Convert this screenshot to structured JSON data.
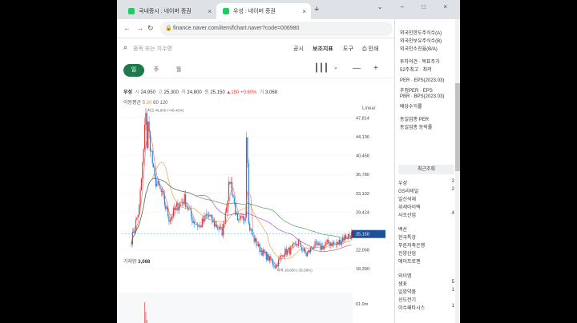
{
  "browser": {
    "tabs": [
      {
        "label": "국내증시 : 네이버 증권",
        "close": "×"
      },
      {
        "label": "우성 : 네이버 증권",
        "close": "×"
      }
    ],
    "new_tab": "+",
    "window_controls": "⌄ – □ ×",
    "url": "finance.naver.com/item/fchart.naver?code=006980"
  },
  "page": {
    "search_placeholder": "종목 또는 지수명",
    "header_links": [
      "공시",
      "보조지표",
      "도구",
      "인쇄"
    ],
    "periods": [
      "일",
      "주",
      "월"
    ],
    "active_period": "일",
    "quote": {
      "name": "우성",
      "open_label": "시",
      "open": "24,950",
      "high_label": "고",
      "high": "25,300",
      "low_label": "저",
      "low": "24,800",
      "close_label": "종",
      "close": "25,150",
      "change": "▲150",
      "change_pct": "+0.60%",
      "volume_label": "거",
      "volume": "3,068"
    },
    "ma_label": "이동평균",
    "ma_values": [
      "5",
      "20",
      "60",
      "120"
    ],
    "ma_colors": [
      "#ef5350",
      "#e08a2a",
      "#9c27b0",
      "#2e7d32"
    ],
    "scale_label": "Linear",
    "volume_title": "거래량",
    "volume_value": "3,068"
  },
  "chart_data": {
    "type": "line",
    "y_ticks": [
      "47,814",
      "44,136",
      "40,458",
      "36,780",
      "33,102",
      "29,424",
      "25,150",
      "22,068",
      "18,390"
    ],
    "current_price": "25,150",
    "max_annotation": "최고 48,800 (+48.46%)",
    "min_annotation": "최저 18,800 (-35.58%)",
    "x_ticks": [
      "4월",
      "8월",
      "2022",
      "4월",
      "8월",
      "2023",
      "4월"
    ],
    "volume_axis_label": "61.0m",
    "approx_price_series": [
      24000,
      30000,
      48800,
      36000,
      33000,
      28000,
      30500,
      32000,
      28000,
      26500,
      29000,
      27000,
      25500,
      36000,
      27000,
      29000,
      24500,
      22000,
      20500,
      18800,
      21500,
      22000,
      23500,
      21000,
      23000,
      22500,
      23500,
      23000,
      24500,
      25150
    ],
    "series_color": "#ef5350",
    "up_color": "#e53935",
    "down_color": "#1e88e5"
  },
  "right_panel": {
    "lines": [
      "외국인한도주식수(A)",
      "외국인보유주식수(B)",
      "외국인소진율(B/A)",
      "투자의견 · 목표주가",
      "52주최고 · 최저",
      "PER · EPS(2023.03)",
      "추정PER · EPS",
      "PBR · BPS(2023.03)",
      "배당수익률",
      "동일업종 PER",
      "동일업종 등락률"
    ],
    "recent_title": "최근조회",
    "recent_items": [
      {
        "name": "우성",
        "val": "2"
      },
      {
        "name": "GS리테일",
        "val": "2"
      },
      {
        "name": "일신석재",
        "val": ""
      },
      {
        "name": "위세아이텍",
        "val": ""
      },
      {
        "name": "사조산업",
        "val": "4"
      },
      {
        "name": "백산",
        "val": ""
      },
      {
        "name": "한국특강",
        "val": ""
      },
      {
        "name": "푸른저축은행",
        "val": ""
      },
      {
        "name": "진양산업",
        "val": ""
      },
      {
        "name": "에이프로젠",
        "val": ""
      },
      {
        "name": "와이엠",
        "val": ""
      },
      {
        "name": "샘표",
        "val": "5"
      },
      {
        "name": "일양약품",
        "val": "1"
      },
      {
        "name": "선도전기",
        "val": ""
      },
      {
        "name": "이수페타시스",
        "val": "1"
      }
    ]
  }
}
